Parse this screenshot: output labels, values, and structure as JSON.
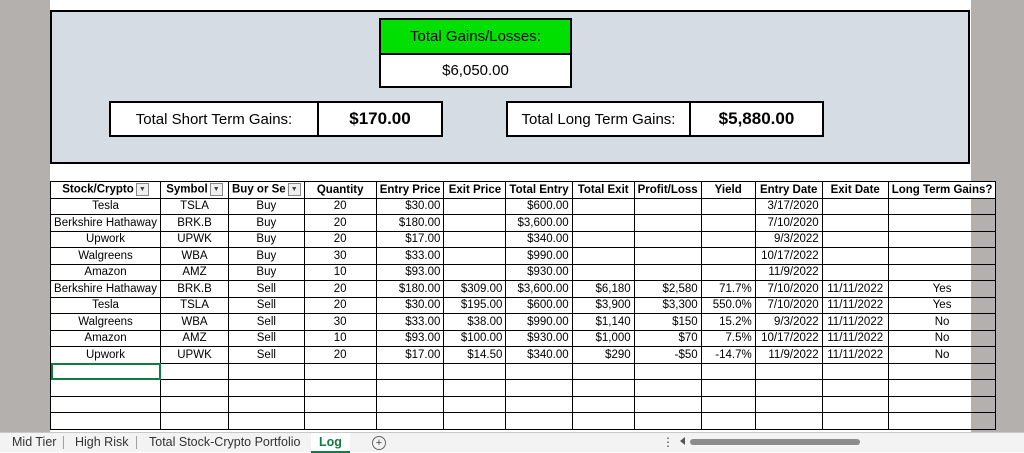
{
  "dashboard": {
    "total_gains_label": "Total Gains/Losses:",
    "total_gains_value": "$6,050.00",
    "short_term_label": "Total Short Term Gains:",
    "short_term_value": "$170.00",
    "long_term_label": "Total Long Term Gains:",
    "long_term_value": "$5,880.00",
    "colors": {
      "header_green": "#00e000",
      "panel_bg": "#d6dce4",
      "sheet_bg": "#b3b0ae"
    }
  },
  "table": {
    "headers": [
      "Stock/Crypto",
      "Symbol",
      "Buy or Se",
      "Quantity",
      "Entry Price",
      "Exit Price",
      "Total Entry",
      "Total Exit",
      "Profit/Loss",
      "Yield",
      "Entry Date",
      "Exit Date",
      "Long Term Gains?"
    ],
    "rows": [
      [
        "Tesla",
        "TSLA",
        "Buy",
        "20",
        "$30.00",
        "",
        "$600.00",
        "",
        "",
        "",
        "3/17/2020",
        "",
        ""
      ],
      [
        "Berkshire Hathaway",
        "BRK.B",
        "Buy",
        "20",
        "$180.00",
        "",
        "$3,600.00",
        "",
        "",
        "",
        "7/10/2020",
        "",
        ""
      ],
      [
        "Upwork",
        "UPWK",
        "Buy",
        "20",
        "$17.00",
        "",
        "$340.00",
        "",
        "",
        "",
        "9/3/2022",
        "",
        ""
      ],
      [
        "Walgreens",
        "WBA",
        "Buy",
        "30",
        "$33.00",
        "",
        "$990.00",
        "",
        "",
        "",
        "10/17/2022",
        "",
        ""
      ],
      [
        "Amazon",
        "AMZ",
        "Buy",
        "10",
        "$93.00",
        "",
        "$930.00",
        "",
        "",
        "",
        "11/9/2022",
        "",
        ""
      ],
      [
        "Berkshire Hathaway",
        "BRK.B",
        "Sell",
        "20",
        "$180.00",
        "$309.00",
        "$3,600.00",
        "$6,180",
        "$2,580",
        "71.7%",
        "7/10/2020",
        "11/11/2022",
        "Yes"
      ],
      [
        "Tesla",
        "TSLA",
        "Sell",
        "20",
        "$30.00",
        "$195.00",
        "$600.00",
        "$3,900",
        "$3,300",
        "550.0%",
        "7/10/2020",
        "11/11/2022",
        "Yes"
      ],
      [
        "Walgreens",
        "WBA",
        "Sell",
        "30",
        "$33.00",
        "$38.00",
        "$990.00",
        "$1,140",
        "$150",
        "15.2%",
        "9/3/2022",
        "11/11/2022",
        "No"
      ],
      [
        "Amazon",
        "AMZ",
        "Sell",
        "10",
        "$93.00",
        "$100.00",
        "$930.00",
        "$1,000",
        "$70",
        "7.5%",
        "10/17/2022",
        "11/11/2022",
        "No"
      ],
      [
        "Upwork",
        "UPWK",
        "Sell",
        "20",
        "$17.00",
        "$14.50",
        "$340.00",
        "$290",
        "-$50",
        "-14.7%",
        "11/9/2022",
        "11/11/2022",
        "No"
      ]
    ]
  },
  "tabs": {
    "mid_tier": "Mid Tier",
    "high_risk": "High Risk",
    "portfolio": "Total Stock-Crypto Portfolio",
    "log": "Log",
    "add": "+"
  }
}
